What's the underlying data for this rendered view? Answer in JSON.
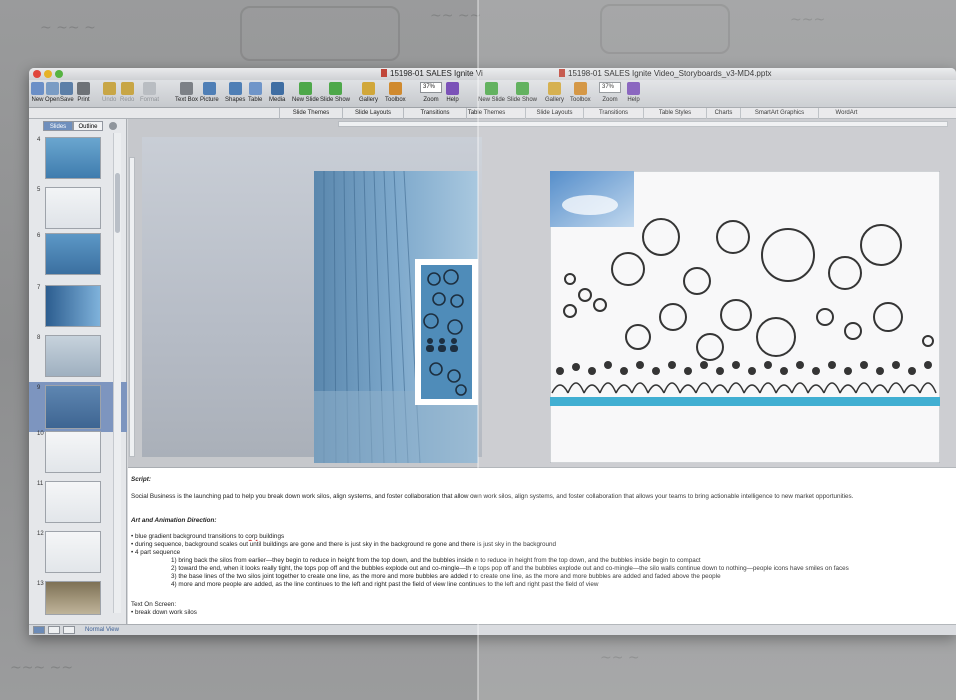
{
  "left_window": {
    "title": "15198-01 SALES Ignite Vi",
    "toolbar": [
      {
        "label": "New",
        "icon": "new-icon",
        "color": "#6b8fc7"
      },
      {
        "label": "Open",
        "icon": "open-icon",
        "color": "#7a9cc4"
      },
      {
        "label": "Save",
        "icon": "save-icon",
        "color": "#5c7fa8"
      },
      {
        "label": "Print",
        "icon": "print-icon",
        "color": "#6e7277"
      },
      {
        "label": "Undo",
        "icon": "undo-icon",
        "color": "#c8a646"
      },
      {
        "label": "Redo",
        "icon": "redo-icon",
        "color": "#c8a646"
      },
      {
        "label": "Format",
        "icon": "format-icon",
        "color": "#b9bdc2"
      },
      {
        "label": "Text Box",
        "icon": "textbox-icon",
        "color": "#7c8086"
      },
      {
        "label": "Picture",
        "icon": "picture-icon",
        "color": "#4f7fb6"
      },
      {
        "label": "Shapes",
        "icon": "shapes-icon",
        "color": "#4f7fb6"
      },
      {
        "label": "Table",
        "icon": "table-icon",
        "color": "#6f95c9"
      },
      {
        "label": "Media",
        "icon": "media-icon",
        "color": "#3f6ea3"
      },
      {
        "label": "New Slide",
        "icon": "newslide-icon",
        "color": "#4ea84a"
      },
      {
        "label": "Slide Show",
        "icon": "slideshow-icon",
        "color": "#4ea84a"
      },
      {
        "label": "Gallery",
        "icon": "gallery-icon",
        "color": "#d1a73a"
      },
      {
        "label": "Toolbox",
        "icon": "toolbox-icon",
        "color": "#d08a2e"
      },
      {
        "label": "Zoom",
        "icon": "zoom-icon",
        "color": "#ffffff"
      },
      {
        "label": "Help",
        "icon": "help-icon",
        "color": "#7b52b8"
      }
    ],
    "zoom_value": "37%",
    "ribbon_tabs": [
      "Slide Themes",
      "Slide Layouts",
      "Transitions",
      "Table Themes"
    ],
    "sidebar_tabs": [
      "Slides",
      "Outline"
    ],
    "slide_numbers": [
      "4",
      "5",
      "6",
      "7",
      "8",
      "9",
      "10",
      "11",
      "12",
      "13"
    ],
    "selected_slide": "9",
    "status_view": "Normal View"
  },
  "right_window": {
    "title": "15198-01 SALES Ignite Video_Storyboards_v3-MD4.pptx",
    "toolbar": [
      {
        "label": "New Slide",
        "icon": "newslide-icon",
        "color": "#4ea84a"
      },
      {
        "label": "Slide Show",
        "icon": "slideshow-icon",
        "color": "#4ea84a"
      },
      {
        "label": "Gallery",
        "icon": "gallery-icon",
        "color": "#d1a73a"
      },
      {
        "label": "Toolbox",
        "icon": "toolbox-icon",
        "color": "#d08a2e"
      },
      {
        "label": "Zoom",
        "icon": "zoom-icon",
        "color": "#ffffff"
      },
      {
        "label": "Help",
        "icon": "help-icon",
        "color": "#7b52b8"
      }
    ],
    "zoom_value": "37%",
    "ribbon_tabs": [
      "Slide Layouts",
      "Transitions",
      "Table Styles",
      "Charts",
      "SmartArt Graphics",
      "WordArt"
    ]
  },
  "notes": {
    "script_heading": "Script:",
    "script_text": "Social Business is the launching pad to help you break down work silos, align systems, and foster collaboration that allow own work silos, align systems, and foster collaboration that allows your teams to bring actionable intelligence to new market opportunities.",
    "art_heading": "Art and Animation Direction:",
    "bullet1_pre": "• blue gradient background transitions to ",
    "bullet1_err": "corp",
    "bullet1_post": " buildings",
    "bullet2": "• during sequence, background scales out until buildings are gone and there is just sky in the background                                                              re gone and there is just sky in the background",
    "bullet3": "• 4 part sequence",
    "step1": "1) bring back the silos from earlier—they begin to reduce in height from the top down, and the bubbles inside                                   n to reduce in height from the top down, and the bubbles inside begin to compact",
    "step2": "2) toward the end, when it looks really tight, the tops pop off and the bubbles explode out and co-mingle—th                                   e tops pop off and the bubbles explode out and co-mingle—the silo walls continue down to nothing—people icons have smiles on faces",
    "step3": "3) the base lines of the two silos joint together to create one line, as the more and more bubbles are added                                    r to create one line, as the more and more bubbles are added and faded above the people",
    "step4": "4) more and more people are added, as the line continues to the left and right past the field of view                                   line continues to the left and right past the field of view",
    "text_on_screen": "Text On Screen:",
    "bullet4": "• break down work silos"
  }
}
